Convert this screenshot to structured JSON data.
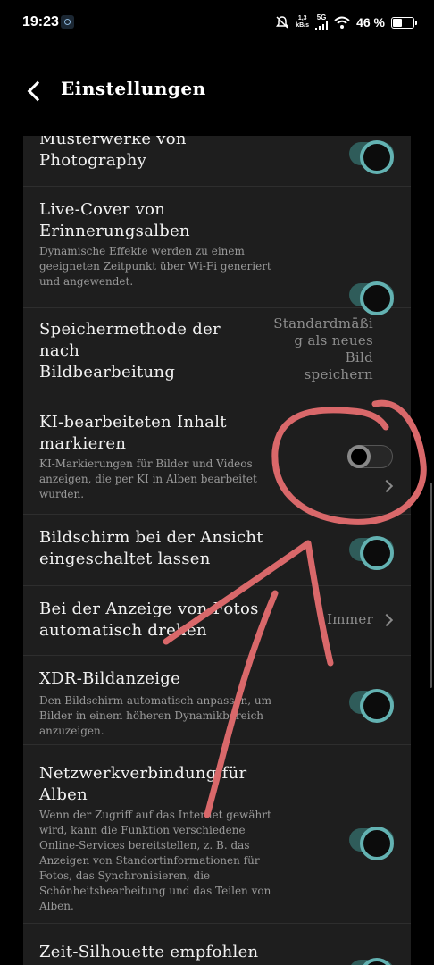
{
  "status_bar": {
    "time": "19:23",
    "net_speed_value": "1,3",
    "net_speed_unit": "kB/s",
    "network": "5G",
    "battery": "46 %",
    "battery_level": 0.46
  },
  "app_bar": {
    "title": "Einstellungen"
  },
  "settings": [
    {
      "title": "Musterwerke von\nPhotography",
      "toggle": "on"
    },
    {
      "title": "Live-Cover von\nErinnerungsalben",
      "description": "Dynamische Effekte werden zu einem\ngeeigneten Zeitpunkt über Wi-Fi generiert\nund angewendet.",
      "toggle": "on"
    },
    {
      "title": "Speichermethode der\nnach\nBildbearbeitung",
      "value": "Standardmäßi\ng als neues\nBild\nspeichern"
    },
    {
      "title": "KI-bearbeiteten Inhalt\nmarkieren",
      "description": "KI-Markierungen für Bilder und Videos\nanzeigen, die per KI in Alben bearbeitet\nwurden.",
      "toggle": "off"
    },
    {
      "title": "Bildschirm bei der Ansicht\neingeschaltet lassen",
      "toggle": "on"
    },
    {
      "title": "Bei der Anzeige von Fotos\nautomatisch drehen",
      "value": "Immer"
    },
    {
      "title": "XDR-Bildanzeige",
      "description": "Den Bildschirm automatisch anpassen, um\nBilder in einem höheren Dynamikbereich\nanzuzeigen.",
      "toggle": "on"
    },
    {
      "title": "Netzwerkverbindung für\nAlben",
      "description": "Wenn der Zugriff auf das Internet gewährt\nwird, kann die Funktion verschiedene\nOnline-Services bereitstellen, z. B. das\nAnzeigen von Standortinformationen für\nFotos, das Synchronisieren, die\nSchönheitsbearbeitung und das Teilen von\nAlben.",
      "toggle": "on"
    },
    {
      "title": "Zeit-Silhouette empfohlen"
    }
  ],
  "colors": {
    "background": "#000000",
    "panel": "#1e1e1e",
    "toggle_on_track": "#2f5c5a",
    "toggle_on_ring": "#63b2b2",
    "annotation": "#d9686a"
  }
}
